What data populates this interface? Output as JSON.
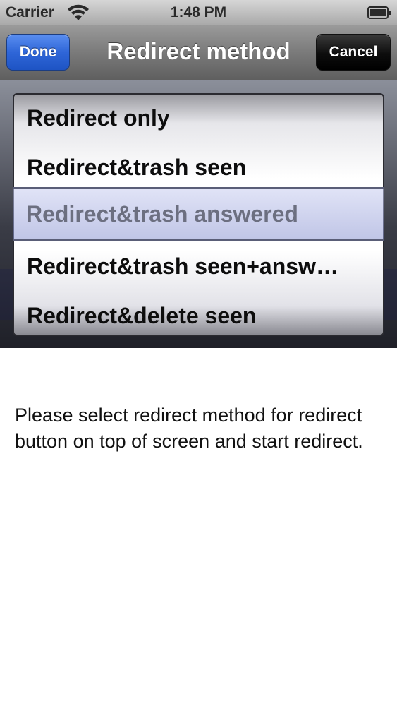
{
  "status_bar": {
    "carrier": "Carrier",
    "time": "1:48 PM",
    "wifi_icon": "wifi-icon",
    "battery_icon": "battery-icon"
  },
  "nav_bar": {
    "title": "Redirect method",
    "done_label": "Done",
    "cancel_label": "Cancel"
  },
  "picker": {
    "options": [
      "Redirect only",
      "Redirect&trash seen",
      "Redirect&trash answered",
      "Redirect&trash seen+answ…",
      "Redirect&delete seen"
    ],
    "selected_index": 2
  },
  "instruction": "Please select redirect method for redirect button on top of screen and start redirect.",
  "colors": {
    "done_button": "#2f66d8",
    "cancel_button": "#0d0d0d",
    "nav_bar": "#7d7d7d"
  }
}
